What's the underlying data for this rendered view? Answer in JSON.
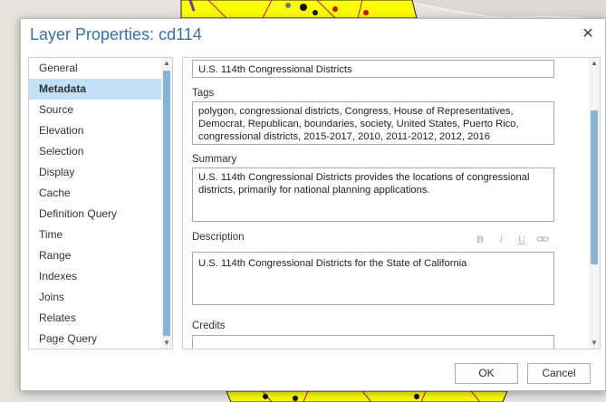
{
  "dialog": {
    "title": "Layer Properties: cd114",
    "close_glyph": "✕"
  },
  "sidebar": {
    "items": [
      {
        "label": "General",
        "active": false
      },
      {
        "label": "Metadata",
        "active": true
      },
      {
        "label": "Source",
        "active": false
      },
      {
        "label": "Elevation",
        "active": false
      },
      {
        "label": "Selection",
        "active": false
      },
      {
        "label": "Display",
        "active": false
      },
      {
        "label": "Cache",
        "active": false
      },
      {
        "label": "Definition Query",
        "active": false
      },
      {
        "label": "Time",
        "active": false
      },
      {
        "label": "Range",
        "active": false
      },
      {
        "label": "Indexes",
        "active": false
      },
      {
        "label": "Joins",
        "active": false
      },
      {
        "label": "Relates",
        "active": false
      },
      {
        "label": "Page Query",
        "active": false
      }
    ]
  },
  "metadata": {
    "title_value": "U.S. 114th Congressional Districts",
    "tags_label": "Tags",
    "tags_value": "polygon, congressional districts, Congress, House of Representatives, Democrat, Republican, boundaries, society, United States, Puerto Rico, congressional districts, 2015-2017, 2010, 2011-2012, 2012, 2016",
    "summary_label": "Summary",
    "summary_value": "U.S. 114th Congressional Districts provides the locations of congressional districts, primarily for national planning applications.",
    "description_label": "Description",
    "description_value": "U.S. 114th Congressional Districts for the State of California",
    "credits_label": "Credits",
    "credits_value": ""
  },
  "format_toolbar": {
    "bold": "B",
    "italic": "I",
    "underline": "U",
    "link_icon": "link-icon"
  },
  "buttons": {
    "ok": "OK",
    "cancel": "Cancel"
  },
  "colors": {
    "title": "#3a6fa1",
    "selected_item": "#bfe0f5",
    "scroll_thumb": "#87b4d6",
    "map_fill": "#ffff00",
    "map_boundary": "#c0147a"
  }
}
